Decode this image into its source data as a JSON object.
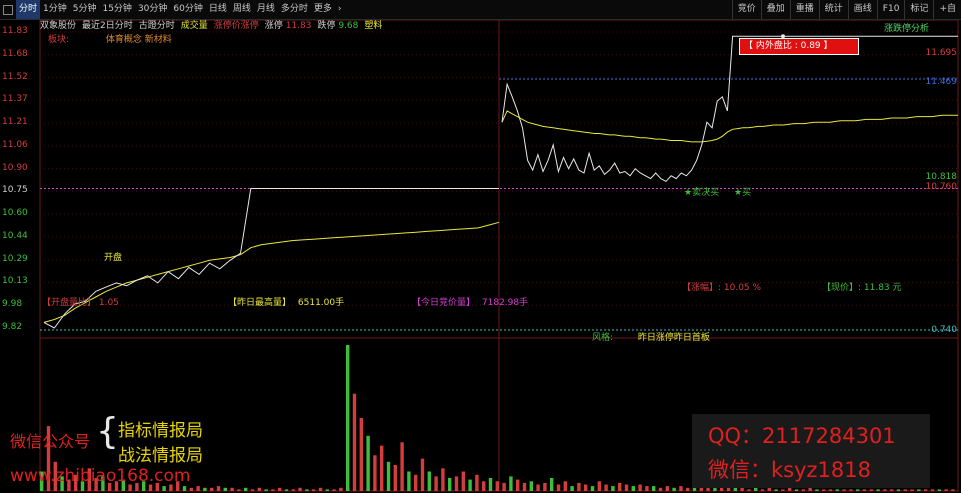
{
  "toolbar": {
    "tabs": [
      "分时",
      "1分钟",
      "5分钟",
      "15分钟",
      "30分钟",
      "60分钟",
      "日线",
      "周线",
      "月线",
      "多分时",
      "更多"
    ],
    "active_tab": 0,
    "more_arrow": "›",
    "right_tools": [
      "竞价",
      "叠加",
      "重播",
      "统计",
      "画线",
      "F10",
      "标记",
      "+自"
    ]
  },
  "info": {
    "name": "双象股份",
    "mode": "最近2日分时",
    "period": "古蹬分时",
    "vol_label": "成交量",
    "vol_label_color": "#e8e83a",
    "ind_label": "涨停价涨停",
    "ind_label_color": "#d43d3d",
    "limit_up_label": "涨停",
    "limit_up_value": "11.83",
    "limit_down_label": "跌停",
    "limit_down_value": "9.68",
    "sector": "塑料"
  },
  "plate": {
    "label": "板块:",
    "concepts": "体育概念 新材料"
  },
  "zdt_button": "涨跌停分析",
  "yaxis": {
    "ticks": [
      "11.83",
      "11.68",
      "11.52",
      "11.37",
      "11.21",
      "11.06",
      "10.90",
      "10.75",
      "10.60",
      "10.44",
      "10.29",
      "10.13",
      "9.98",
      "9.82"
    ],
    "prev_close_index": 7
  },
  "right_labels": {
    "top": "11.695",
    "blue": "11.469",
    "green": "10.818",
    "magenta": "10.760",
    "bottom": "0.740"
  },
  "annotations": {
    "inout_ratio": "【 内外盘比 : 0.89 】",
    "open_ratio": "【开盘量比】 1.05",
    "yday_max": "【昨日最高量】",
    "yday_max_value": "6511.00手",
    "today_auction": "【今日竞价量】",
    "today_auction_value": "7182.98手",
    "rise_label": "【涨幅】: 10.05 %",
    "price_label": "【现价】: 11.83 元",
    "style_label": "风格:",
    "style_value": "昨日涨停昨日首板",
    "open_mark": "开盘",
    "buy_mark_1": "★卖决买",
    "buy_mark_2": "★买"
  },
  "watermark": {
    "left_prefix": "微信公众号",
    "left_line1": "指标情报局",
    "left_line2": "战法情报局",
    "left_url": "www.zhibiao168.com",
    "qq": "QQ：2117284301",
    "wechat": "微信：ksyz1818"
  },
  "chart_data": {
    "type": "line",
    "ylim": [
      9.76,
      11.86
    ],
    "prev_close": 10.75,
    "days": [
      {
        "name": "day1",
        "price": [
          9.8,
          9.76,
          9.86,
          9.93,
          9.95,
          10.02,
          10.05,
          10.08,
          10.06,
          10.1,
          10.13,
          10.08,
          10.16,
          10.11,
          10.19,
          10.14,
          10.22,
          10.18,
          10.24,
          10.29,
          10.75,
          10.75,
          10.75,
          10.75,
          10.75,
          10.75,
          10.75,
          10.75,
          10.75,
          10.75,
          10.75,
          10.75,
          10.75,
          10.75,
          10.75,
          10.75,
          10.75,
          10.75,
          10.75,
          10.75,
          10.75,
          10.75,
          10.75,
          10.75,
          10.75
        ],
        "avg": [
          9.8,
          9.82,
          9.85,
          9.9,
          9.94,
          9.98,
          10.02,
          10.05,
          10.08,
          10.1,
          10.12,
          10.14,
          10.16,
          10.18,
          10.2,
          10.22,
          10.24,
          10.25,
          10.26,
          10.28,
          10.33,
          10.35,
          10.36,
          10.37,
          10.38,
          10.385,
          10.39,
          10.395,
          10.4,
          10.405,
          10.41,
          10.415,
          10.42,
          10.425,
          10.43,
          10.435,
          10.44,
          10.445,
          10.45,
          10.455,
          10.46,
          10.465,
          10.47,
          10.49,
          10.51
        ]
      },
      {
        "name": "day2",
        "price": [
          11.22,
          11.49,
          11.4,
          11.3,
          11.18,
          10.95,
          10.88,
          10.99,
          10.87,
          10.95,
          11.06,
          10.87,
          10.97,
          10.89,
          10.96,
          10.88,
          10.86,
          11.0,
          10.88,
          10.91,
          10.85,
          10.88,
          10.93,
          10.86,
          10.87,
          10.84,
          10.89,
          10.86,
          10.84,
          10.82,
          10.86,
          10.82,
          10.8,
          10.84,
          10.82,
          10.86,
          10.84,
          10.88,
          10.95,
          11.06,
          11.22,
          11.18,
          11.37,
          11.4,
          11.3,
          11.83,
          11.83,
          11.83,
          11.83,
          11.83,
          11.83,
          11.83,
          11.83,
          11.83,
          11.83,
          11.83,
          11.83,
          11.83,
          11.83,
          11.83,
          11.83,
          11.83,
          11.83,
          11.83,
          11.83,
          11.83,
          11.83,
          11.83,
          11.83,
          11.83,
          11.83,
          11.83,
          11.83,
          11.83,
          11.83,
          11.83,
          11.83,
          11.83,
          11.83,
          11.83,
          11.83,
          11.83,
          11.83,
          11.83,
          11.83,
          11.83,
          11.83,
          11.83,
          11.83,
          11.83
        ],
        "avg": [
          11.22,
          11.3,
          11.28,
          11.26,
          11.24,
          11.22,
          11.21,
          11.2,
          11.19,
          11.185,
          11.18,
          11.175,
          11.17,
          11.165,
          11.16,
          11.155,
          11.15,
          11.145,
          11.14,
          11.14,
          11.135,
          11.13,
          11.13,
          11.125,
          11.12,
          11.12,
          11.115,
          11.11,
          11.11,
          11.105,
          11.1,
          11.1,
          11.095,
          11.09,
          11.09,
          11.09,
          11.085,
          11.08,
          11.08,
          11.08,
          11.085,
          11.09,
          11.1,
          11.12,
          11.15,
          11.17,
          11.175,
          11.18,
          11.18,
          11.185,
          11.19,
          11.19,
          11.195,
          11.2,
          11.2,
          11.2,
          11.205,
          11.21,
          11.21,
          11.21,
          11.215,
          11.22,
          11.22,
          11.22,
          11.22,
          11.225,
          11.23,
          11.23,
          11.23,
          11.23,
          11.235,
          11.24,
          11.24,
          11.24,
          11.24,
          11.245,
          11.25,
          11.25,
          11.25,
          11.25,
          11.255,
          11.26,
          11.26,
          11.26,
          11.26,
          11.265,
          11.27,
          11.27,
          11.27,
          11.27
        ]
      }
    ],
    "volume": [
      12,
      40,
      18,
      9,
      7,
      10,
      6,
      14,
      8,
      9,
      5,
      6,
      7,
      4,
      5,
      6,
      4,
      5,
      3,
      4,
      6,
      3,
      2,
      3,
      2,
      2,
      3,
      2,
      2,
      1,
      2,
      1,
      2,
      1,
      1,
      2,
      1,
      1,
      2,
      1,
      1,
      2,
      1,
      1,
      2,
      90,
      60,
      45,
      34,
      22,
      28,
      18,
      16,
      30,
      12,
      10,
      20,
      12,
      9,
      14,
      8,
      9,
      12,
      7,
      10,
      6,
      8,
      6,
      5,
      9,
      7,
      5,
      6,
      4,
      5,
      8,
      4,
      6,
      3,
      5,
      4,
      3,
      6,
      4,
      3,
      5,
      4,
      3,
      4,
      3,
      3,
      2,
      3,
      2,
      3,
      2,
      3,
      2,
      2,
      2,
      3,
      2,
      2,
      2,
      1,
      2,
      1,
      2,
      1,
      1,
      2,
      1,
      1,
      2,
      1,
      1,
      1,
      1,
      1,
      1,
      1,
      1,
      1,
      1,
      1,
      1,
      1,
      1,
      1,
      1,
      1,
      1,
      1,
      1,
      1
    ],
    "colors": {
      "price": "#e8e8e8",
      "avg": "#e8e83a",
      "up_volume": "#d43d3d",
      "down_volume": "#3cbf3c"
    }
  }
}
